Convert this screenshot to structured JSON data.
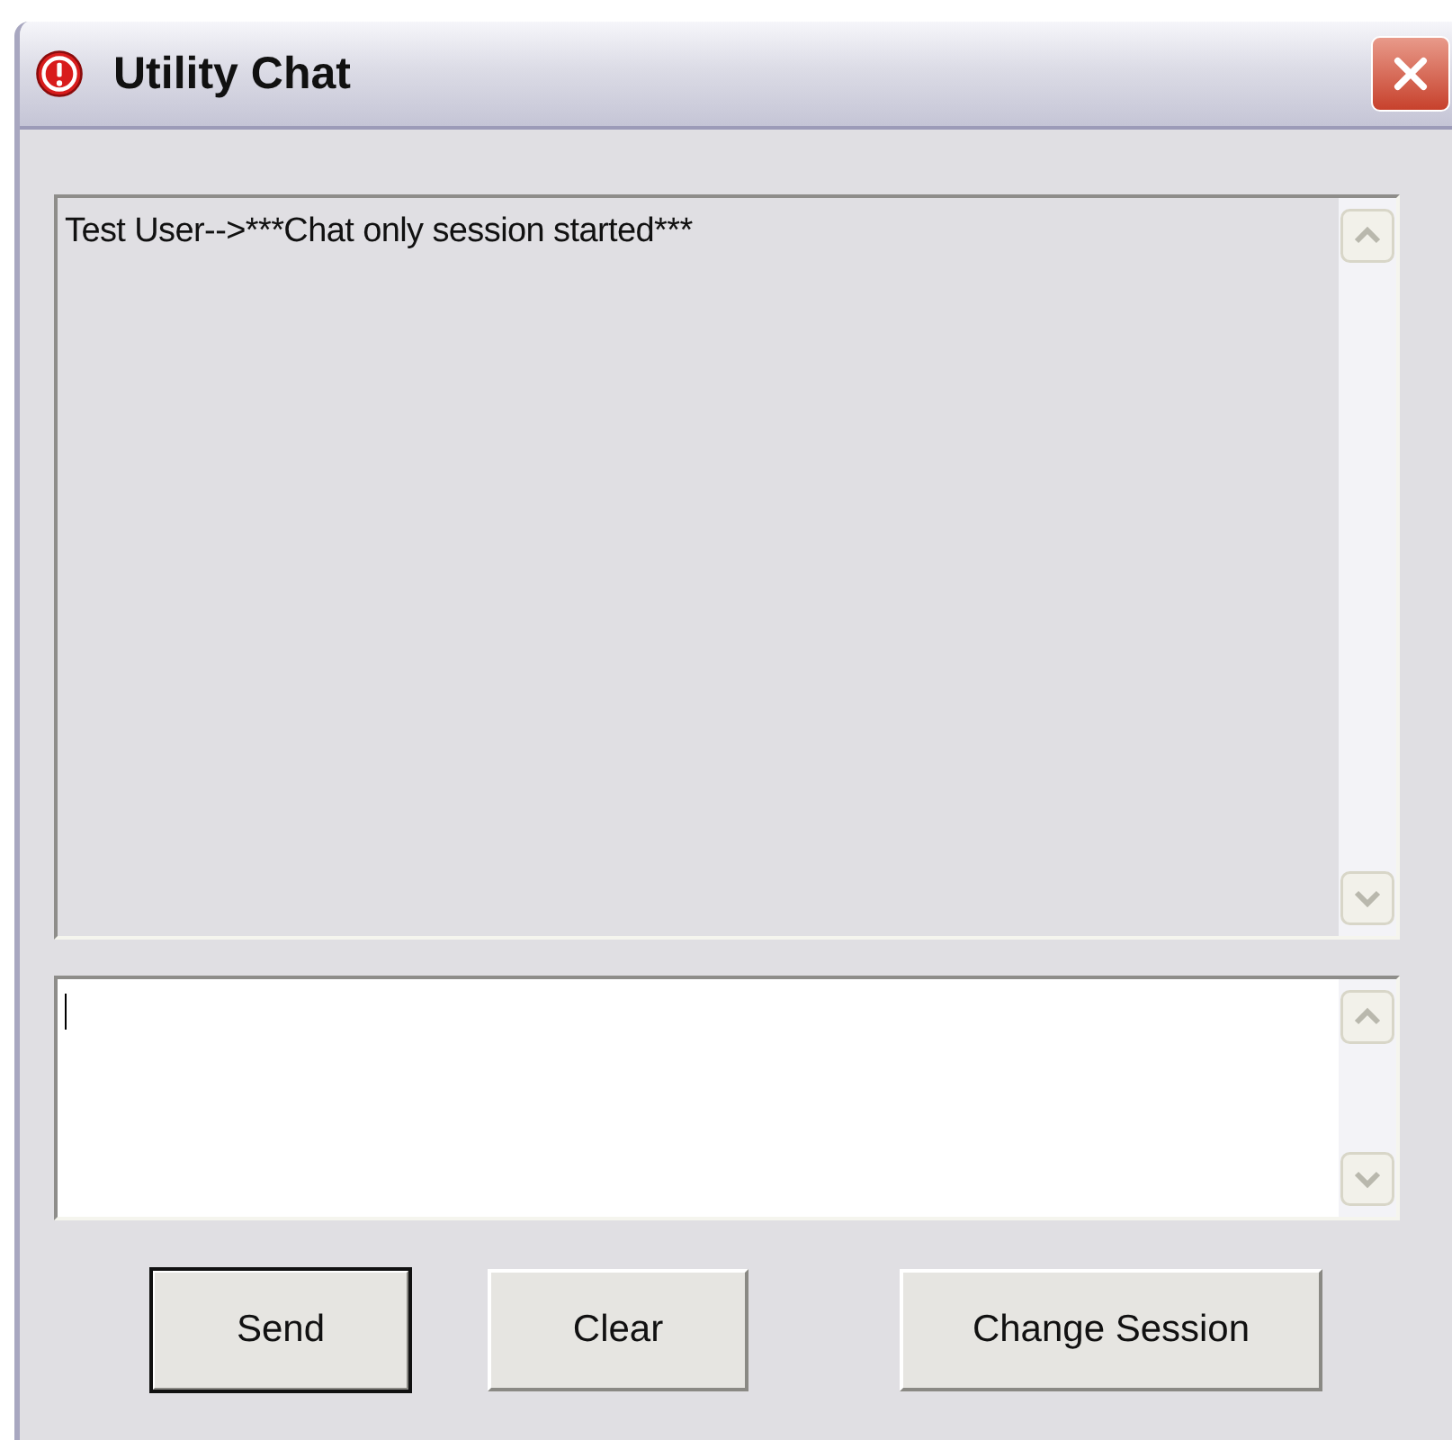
{
  "window": {
    "title": "Utility Chat"
  },
  "chat_log": {
    "messages": [
      "Test User-->***Chat only session started***"
    ],
    "disabled": true
  },
  "message_input": {
    "focused": true
  },
  "buttons": [
    {
      "label": "Send",
      "default": true
    },
    {
      "label": "Clear",
      "default": false
    },
    {
      "label": "Change Session",
      "default": false
    }
  ]
}
